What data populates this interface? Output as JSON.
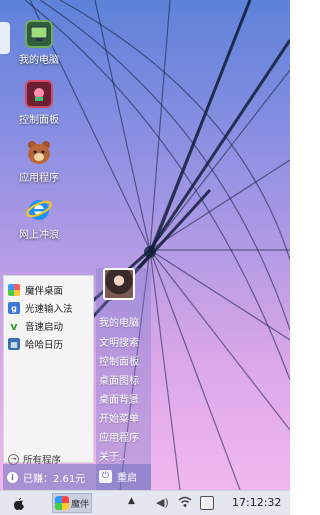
{
  "desktop": {
    "icons": [
      {
        "label": "我的电脑",
        "icon": "computer-icon"
      },
      {
        "label": "控制面板",
        "icon": "control-panel-icon"
      },
      {
        "label": "应用程序",
        "icon": "apps-bear-icon"
      },
      {
        "label": "网上冲浪",
        "icon": "internet-explorer-icon"
      }
    ]
  },
  "start_menu": {
    "programs": [
      {
        "label": "魔伴桌面",
        "icon": "pinwheel-icon",
        "color": "#ff5a5a"
      },
      {
        "label": "光速输入法",
        "icon": "g-keyboard-icon",
        "color": "#3c78d8"
      },
      {
        "label": "音速启动",
        "icon": "v-launcher-icon",
        "color": "#2e9e2e"
      },
      {
        "label": "哈哈日历",
        "icon": "calendar-icon",
        "color": "#3a6fb0"
      }
    ],
    "all_programs": "所有程序",
    "links": [
      "我的电脑",
      "文明搜索",
      "控制面板",
      "桌面图标",
      "桌面背景",
      "开始菜单",
      "应用程序",
      "关于.."
    ],
    "earned": "已赚：2.61元",
    "restart": "重启"
  },
  "taskbar": {
    "task_label": "魔伴",
    "clock": "17:12:32"
  }
}
